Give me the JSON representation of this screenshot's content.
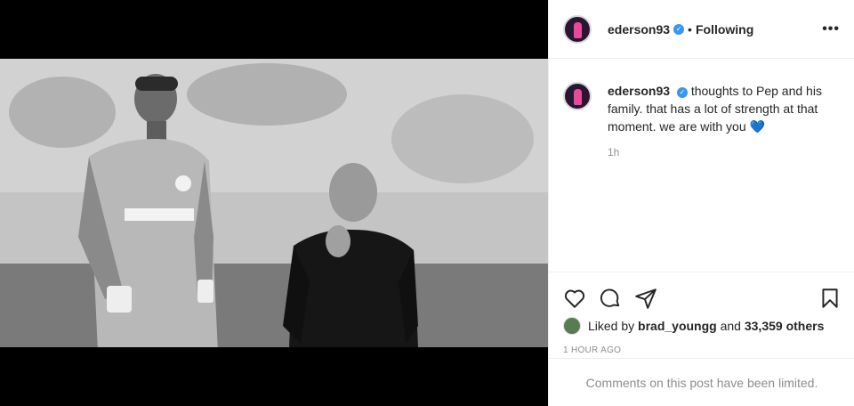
{
  "post": {
    "username": "ederson93",
    "follow_status": "Following",
    "separator": "•",
    "more_label": "•••",
    "caption": "thoughts to Pep and his family. that has a lot of strength at that moment. we are with you",
    "caption_emoji": "💙",
    "caption_time": "1h",
    "liked_by_prefix": "Liked by",
    "liked_by_user": "brad_youngg",
    "liked_by_and": "and",
    "liked_by_others": "33,359 others",
    "posted_ago": "1 HOUR AGO",
    "comments_notice": "Comments on this post have been limited."
  },
  "icons": {
    "verified": "verified-badge-icon",
    "like": "heart-outline-icon",
    "comment": "comment-bubble-icon",
    "share": "paper-plane-icon",
    "save": "bookmark-icon"
  },
  "colors": {
    "verified": "#3897f0",
    "muted_text": "#8e8e8e",
    "divider": "#efefef",
    "emoji_heart": "#3fa9e0"
  }
}
